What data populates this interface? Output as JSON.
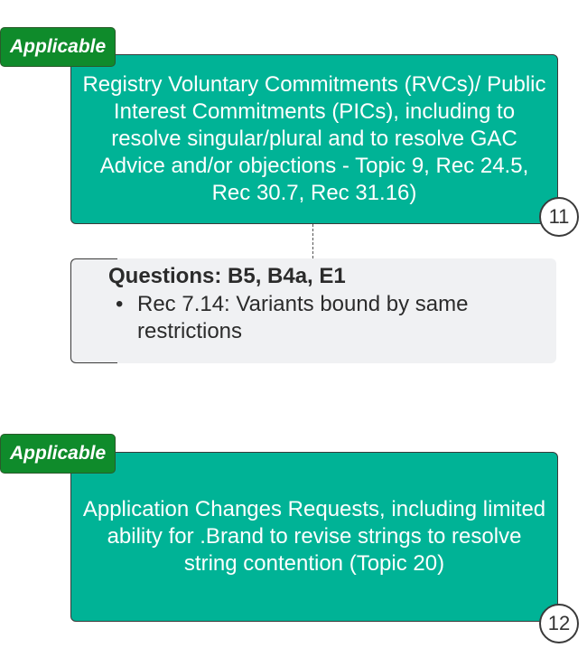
{
  "cards": [
    {
      "tag": "Applicable",
      "text": "Registry Voluntary Commitments (RVCs)/ Public Interest Commitments (PICs), including to resolve singular/plural and to resolve GAC Advice and/or objections - Topic 9, Rec 24.5, Rec 30.7, Rec 31.16)",
      "number": "11"
    },
    {
      "tag": "Applicable",
      "text": "Application Changes Requests, including limited ability for .Brand to revise strings to resolve string contention (Topic 20)",
      "number": "12"
    }
  ],
  "note": {
    "title": "Questions: B5, B4a, E1",
    "items": [
      "Rec 7.14: Variants bound by same restrictions"
    ]
  },
  "colors": {
    "card_fill": "#00b396",
    "tag_fill": "#0f8b2b",
    "note_fill": "#f0f1f3"
  }
}
